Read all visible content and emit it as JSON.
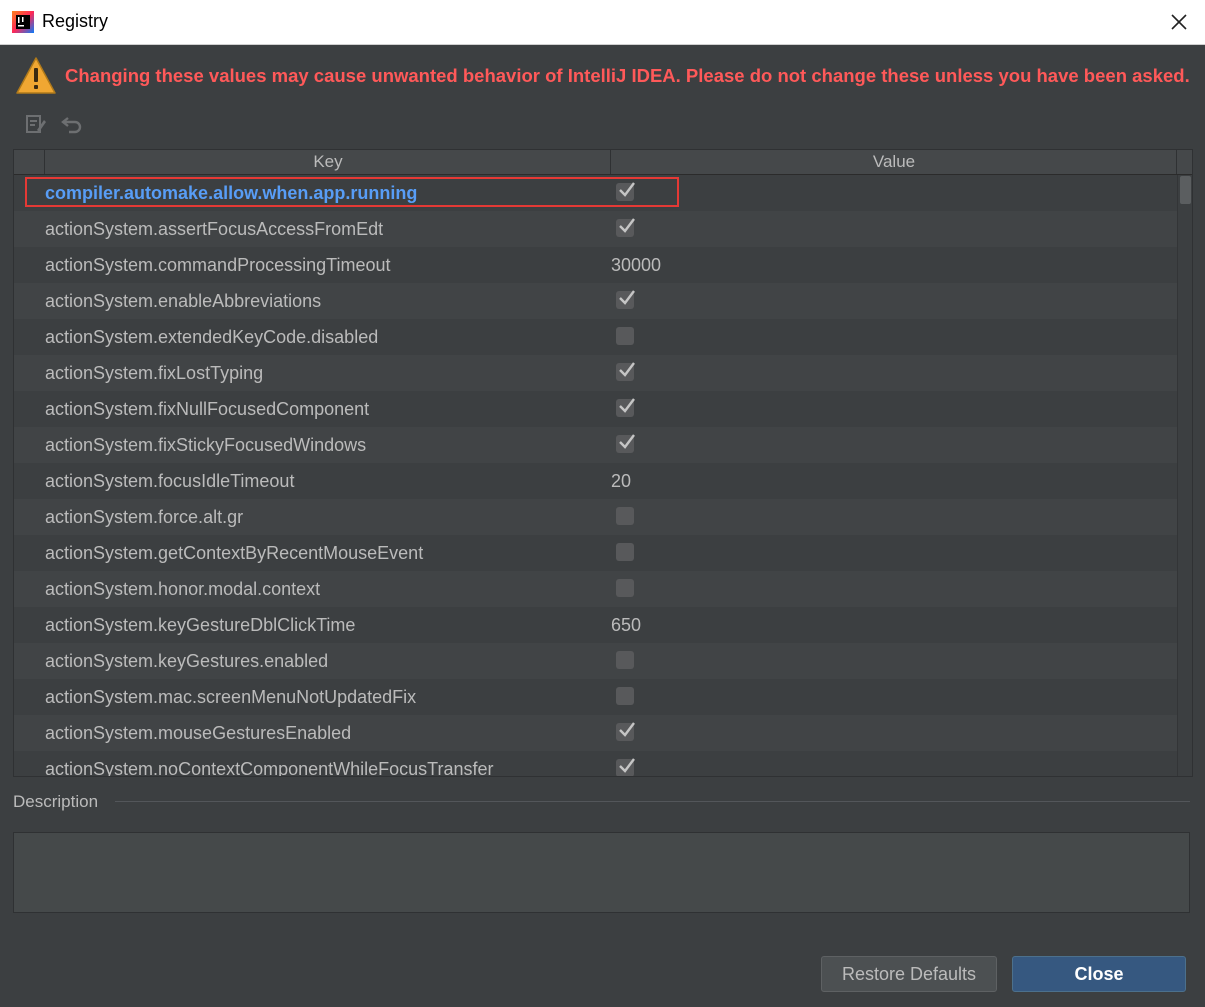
{
  "window": {
    "title": "Registry",
    "close_label": "×"
  },
  "warning": "Changing these values may cause unwanted behavior of IntelliJ IDEA. Please do not change these unless you have been asked.",
  "toolbar": {
    "edit_icon": "edit-icon",
    "revert_icon": "revert-icon"
  },
  "table": {
    "columns": [
      "Key",
      "Value"
    ],
    "rows": [
      {
        "key": "compiler.automake.allow.when.app.running",
        "type": "bool",
        "checked": true,
        "selected": true
      },
      {
        "key": "actionSystem.assertFocusAccessFromEdt",
        "type": "bool",
        "checked": true
      },
      {
        "key": "actionSystem.commandProcessingTimeout",
        "type": "text",
        "value": "30000"
      },
      {
        "key": "actionSystem.enableAbbreviations",
        "type": "bool",
        "checked": true
      },
      {
        "key": "actionSystem.extendedKeyCode.disabled",
        "type": "bool",
        "checked": false
      },
      {
        "key": "actionSystem.fixLostTyping",
        "type": "bool",
        "checked": true
      },
      {
        "key": "actionSystem.fixNullFocusedComponent",
        "type": "bool",
        "checked": true
      },
      {
        "key": "actionSystem.fixStickyFocusedWindows",
        "type": "bool",
        "checked": true
      },
      {
        "key": "actionSystem.focusIdleTimeout",
        "type": "text",
        "value": "20"
      },
      {
        "key": "actionSystem.force.alt.gr",
        "type": "bool",
        "checked": false
      },
      {
        "key": "actionSystem.getContextByRecentMouseEvent",
        "type": "bool",
        "checked": false
      },
      {
        "key": "actionSystem.honor.modal.context",
        "type": "bool",
        "checked": false
      },
      {
        "key": "actionSystem.keyGestureDblClickTime",
        "type": "text",
        "value": "650"
      },
      {
        "key": "actionSystem.keyGestures.enabled",
        "type": "bool",
        "checked": false
      },
      {
        "key": "actionSystem.mac.screenMenuNotUpdatedFix",
        "type": "bool",
        "checked": false
      },
      {
        "key": "actionSystem.mouseGesturesEnabled",
        "type": "bool",
        "checked": true
      },
      {
        "key": "actionSystem.noContextComponentWhileFocusTransfer",
        "type": "bool",
        "checked": true
      }
    ]
  },
  "description": {
    "label": "Description",
    "text": ""
  },
  "buttons": {
    "restore": "Restore Defaults",
    "close": "Close"
  },
  "colors": {
    "warning": "#ff5959",
    "selected_key": "#589df6",
    "highlight_box": "#e53935",
    "primary_button": "#365880"
  }
}
